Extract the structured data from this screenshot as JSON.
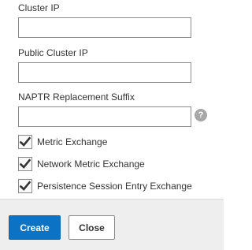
{
  "form": {
    "cluster_ip": {
      "label": "Cluster IP",
      "value": "",
      "placeholder": ""
    },
    "public_cluster_ip": {
      "label": "Public Cluster IP",
      "value": "",
      "placeholder": ""
    },
    "naptr_suffix": {
      "label": "NAPTR Replacement Suffix",
      "value": "",
      "placeholder": "",
      "help_glyph": "?"
    },
    "checkboxes": [
      {
        "label": "Metric Exchange",
        "checked": true
      },
      {
        "label": "Network Metric Exchange",
        "checked": true
      },
      {
        "label": "Persistence Session Entry Exchange",
        "checked": true
      }
    ]
  },
  "footer": {
    "create_label": "Create",
    "close_label": "Close"
  },
  "colors": {
    "primary": "#0c72c4",
    "footer_bg": "#eeeeee",
    "help_icon": "#a7a7a7"
  }
}
